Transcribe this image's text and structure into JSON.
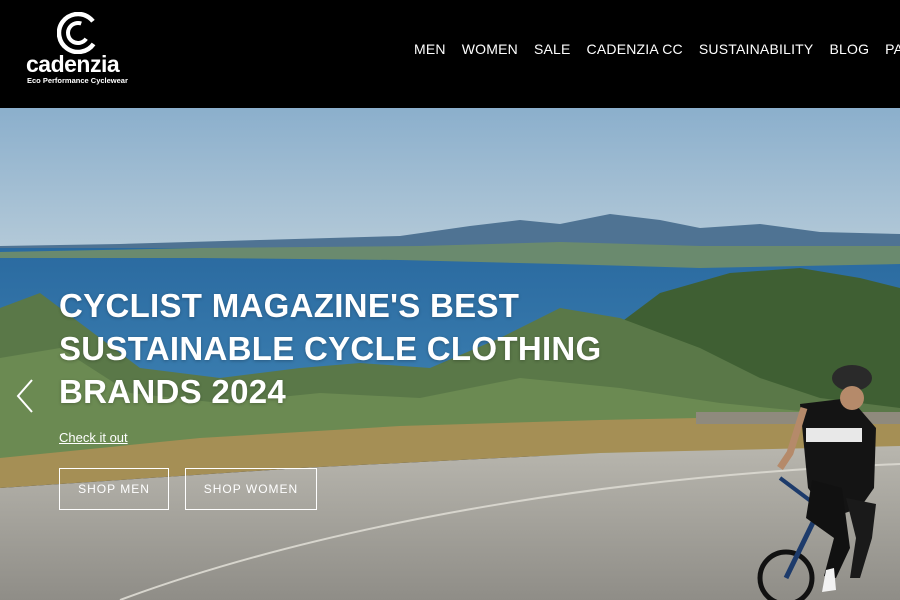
{
  "brand": {
    "name": "cadenzia",
    "tagline": "Eco Performance Cyclewear"
  },
  "nav": {
    "items": [
      "MEN",
      "WOMEN",
      "SALE",
      "CADENZIA CC",
      "SUSTAINABILITY",
      "BLOG",
      "PART"
    ]
  },
  "hero": {
    "headline": "CYCLIST MAGAZINE'S BEST SUSTAINABLE CYCLE CLOTHING BRANDS 2024",
    "link_label": "Check it out",
    "shop_men_label": "SHOP MEN",
    "shop_women_label": "SHOP WOMEN"
  },
  "icons": {
    "logo": "cadenzia-c-logo-icon",
    "prev": "chevron-left-icon"
  },
  "colors": {
    "header_bg": "#000000",
    "text": "#ffffff",
    "sky": "#8fb3cf",
    "sea": "#2f6fa3"
  }
}
